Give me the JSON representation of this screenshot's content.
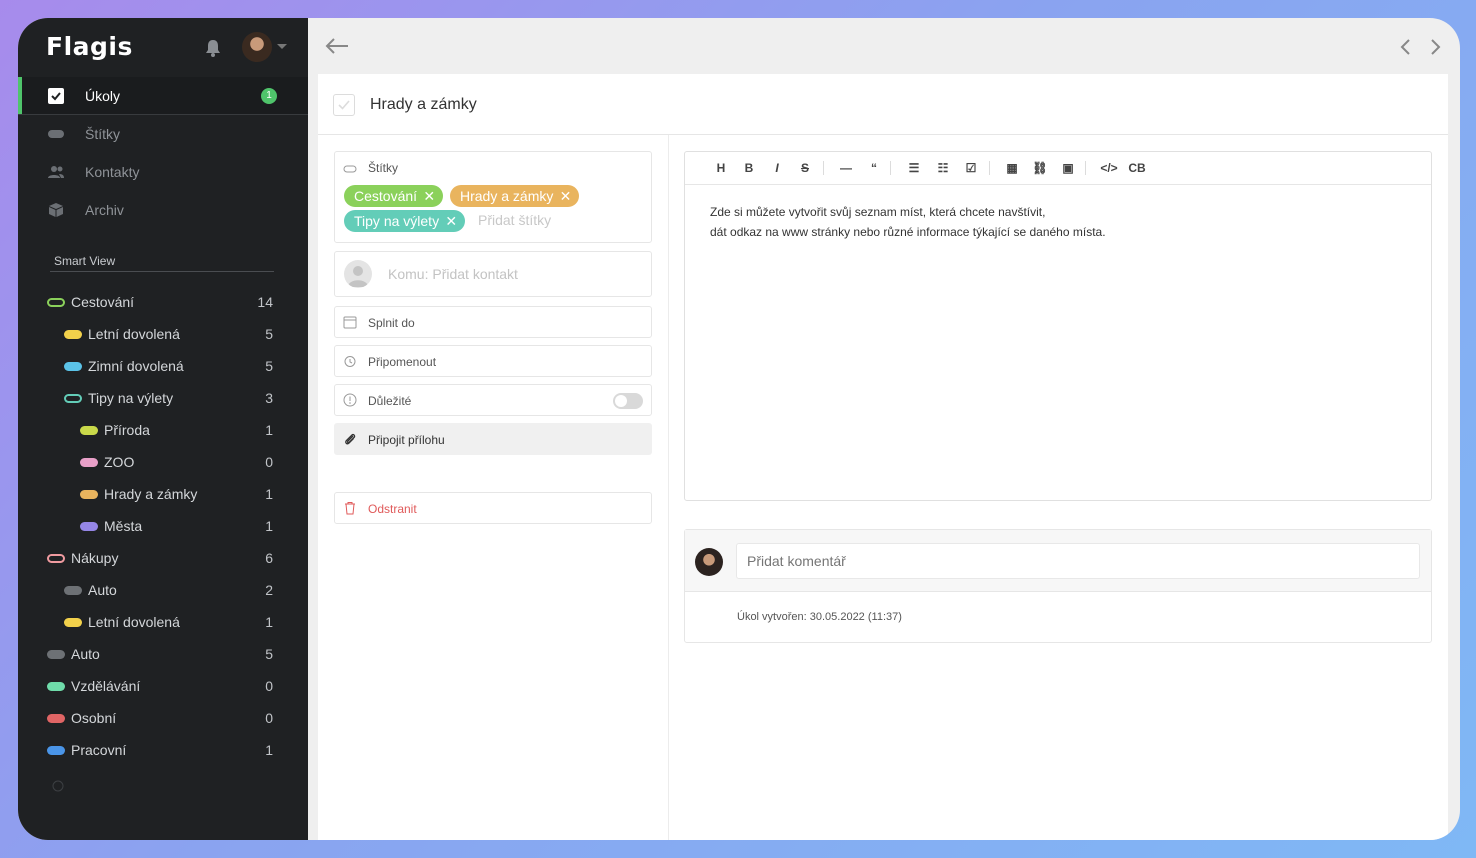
{
  "app": {
    "name": "Flagis"
  },
  "sidebar": {
    "main_items": [
      {
        "label": "Úkoly",
        "badge": "1",
        "icon": "checkbox-icon"
      },
      {
        "label": "Štítky",
        "icon": "tag-icon"
      },
      {
        "label": "Kontakty",
        "icon": "people-icon"
      },
      {
        "label": "Archiv",
        "icon": "box-icon"
      }
    ],
    "smart_view_title": "Smart View",
    "tags": [
      {
        "name": "Cestování",
        "count": "14",
        "color": "#8bd15b",
        "level": 0,
        "style": "outline"
      },
      {
        "name": "Letní dovolená",
        "count": "5",
        "color": "#f2d14b",
        "level": 1,
        "style": "filled"
      },
      {
        "name": "Zimní dovolená",
        "count": "5",
        "color": "#5bc3e8",
        "level": 1,
        "style": "filled"
      },
      {
        "name": "Tipy na výlety",
        "count": "3",
        "color": "#63cdb8",
        "level": 1,
        "style": "outline"
      },
      {
        "name": "Příroda",
        "count": "1",
        "color": "#c9d94a",
        "level": 2,
        "style": "filled"
      },
      {
        "name": "ZOO",
        "count": "0",
        "color": "#e8a0c8",
        "level": 2,
        "style": "filled"
      },
      {
        "name": "Hrady a zámky",
        "count": "1",
        "color": "#e9b45e",
        "level": 2,
        "style": "filled"
      },
      {
        "name": "Města",
        "count": "1",
        "color": "#9586e6",
        "level": 2,
        "style": "filled"
      },
      {
        "name": "Nákupy",
        "count": "6",
        "color": "#f09ba0",
        "level": 0,
        "style": "outline"
      },
      {
        "name": "Auto",
        "count": "2",
        "color": "#6d7175",
        "level": 1,
        "style": "filled"
      },
      {
        "name": "Letní dovolená",
        "count": "1",
        "color": "#f2d14b",
        "level": 1,
        "style": "filled"
      },
      {
        "name": "Auto",
        "count": "5",
        "color": "#6d7175",
        "level": 0,
        "style": "filled"
      },
      {
        "name": "Vzdělávání",
        "count": "0",
        "color": "#6fdcaa",
        "level": 0,
        "style": "filled"
      },
      {
        "name": "Osobní",
        "count": "0",
        "color": "#e06565",
        "level": 0,
        "style": "filled"
      },
      {
        "name": "Pracovní",
        "count": "1",
        "color": "#4a95e8",
        "level": 0,
        "style": "filled"
      }
    ]
  },
  "task": {
    "title": "Hrady a zámky",
    "tags_label": "Štítky",
    "chips": [
      {
        "label": "Cestování",
        "color": "#8bd15b"
      },
      {
        "label": "Hrady a zámky",
        "color": "#e9b45e"
      },
      {
        "label": "Tipy na výlety",
        "color": "#63cdb8"
      }
    ],
    "add_tags_placeholder": "Přidat štítky",
    "contact_placeholder": "Komu: Přidat kontakt",
    "due_label": "Splnit do",
    "remind_label": "Připomenout",
    "important_label": "Důležité",
    "important_on": false,
    "attach_label": "Připojit přílohu",
    "delete_label": "Odstranit",
    "description_lines": [
      "Zde si můžete vytvořit svůj seznam míst, která chcete navštívit,",
      "dát odkaz na www stránky nebo různé informace týkající se daného místa."
    ],
    "comment_placeholder": "Přidat komentář",
    "created_text": "Úkol vytvořen: 30.05.2022 (11:37)"
  },
  "toolbar": {
    "buttons": [
      {
        "label": "H",
        "name": "heading-button"
      },
      {
        "label": "B",
        "name": "bold-button"
      },
      {
        "label": "I",
        "name": "italic-button"
      },
      {
        "label": "S",
        "name": "strikethrough-button"
      },
      {
        "label": "—",
        "name": "horizontal-rule-button"
      },
      {
        "label": "“",
        "name": "quote-button"
      },
      {
        "label": "☰",
        "name": "bullet-list-button"
      },
      {
        "label": "☷",
        "name": "ordered-list-button"
      },
      {
        "label": "☑",
        "name": "task-list-button"
      },
      {
        "label": "▦",
        "name": "table-button"
      },
      {
        "label": "⛓",
        "name": "link-button"
      },
      {
        "label": "▣",
        "name": "image-button"
      },
      {
        "label": "</>",
        "name": "code-button"
      },
      {
        "label": "CB",
        "name": "code-block-button"
      }
    ]
  }
}
